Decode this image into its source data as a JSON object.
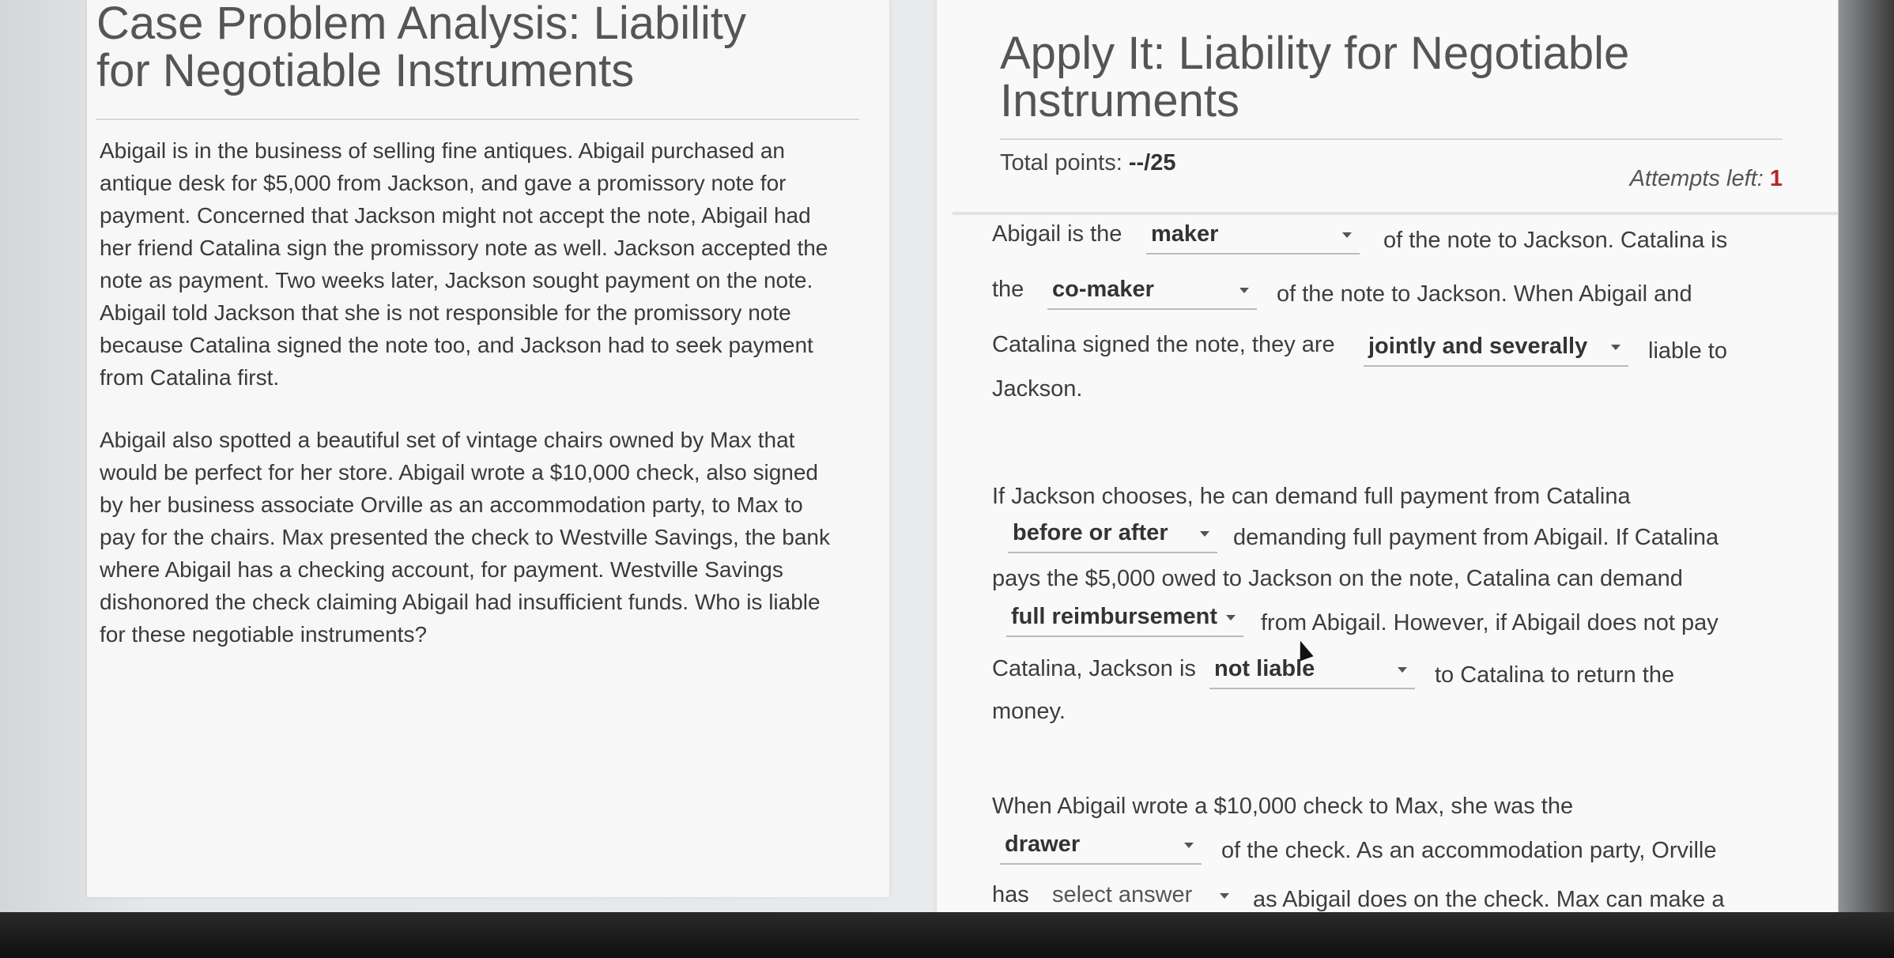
{
  "case": {
    "title": "Case Problem Analysis: Liability for Negotiable Instruments",
    "paragraphs": [
      "Abigail is in the business of selling fine antiques. Abigail purchased an antique desk for $5,000 from Jackson, and gave a promissory note for payment. Concerned that Jackson might not accept the note, Abigail had her friend Catalina sign the promissory note as well. Jackson accepted the note as payment. Two weeks later, Jackson sought payment on the note. Abigail told Jackson that she is not responsible for the promissory note because Catalina signed the note too, and Jackson had to seek payment from Catalina first.",
      "Abigail also spotted a beautiful set of vintage chairs owned by Max that would be perfect for her store. Abigail wrote a $10,000 check, also signed by her business associate Orville as an accommodation party, to Max to pay for the chairs. Max presented the check to Westville Savings, the bank where Abigail has a checking account, for payment. Westville Savings dishonored the check claiming Abigail had insufficient funds. Who is liable for these negotiable instruments?"
    ]
  },
  "apply": {
    "title": "Apply It: Liability for Negotiable Instruments",
    "points_label": "Total points:",
    "points_value": "--/25",
    "attempts_label": "Attempts left:",
    "attempts_value": "1"
  },
  "q1": {
    "t1": "Abigail is the",
    "d1": "maker",
    "t2": "of the note to Jackson. Catalina is",
    "t3": "the",
    "d2": "co-maker",
    "t4": "of the note to Jackson. When Abigail and",
    "t5": "Catalina signed the note, they are",
    "d3": "jointly and severally",
    "t6": "liable to",
    "t7": "Jackson."
  },
  "q2": {
    "t1": "If Jackson chooses, he can demand full payment from Catalina",
    "d1": "before or after",
    "t2": "demanding full payment from Abigail. If Catalina",
    "t3": "pays the $5,000 owed to Jackson on the note, Catalina can demand",
    "d2": "full reimbursement",
    "t4": "from Abigail. However, if Abigail does not pay",
    "t5": "Catalina, Jackson is",
    "d3": "not liable",
    "t6": "to Catalina to return the",
    "t7": "money."
  },
  "q3": {
    "t1": "When Abigail wrote a $10,000 check to Max, she was the",
    "d1": "drawer",
    "t2": "of the check. As an accommodation party, Orville",
    "t3": "has",
    "d2": "select answer",
    "t4": "as Abigail does on the check. Max can make a"
  }
}
